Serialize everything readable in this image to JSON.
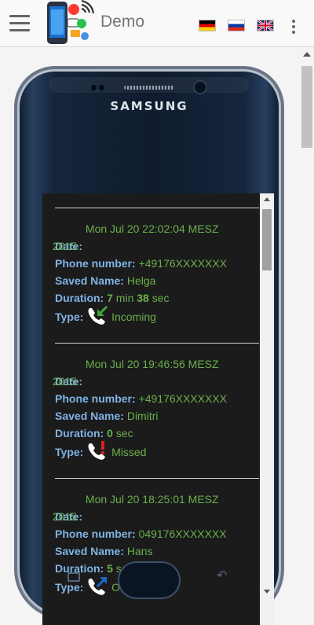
{
  "app": {
    "title": "Demo"
  },
  "flags": [
    {
      "name": "german",
      "colors": [
        "#000000",
        "#dd0000",
        "#ffce00"
      ]
    },
    {
      "name": "russian",
      "colors": [
        "#ffffff",
        "#0039a6",
        "#d52b1e"
      ]
    },
    {
      "name": "english",
      "colors": [
        "#012169",
        "#ffffff",
        "#c8102e"
      ]
    }
  ],
  "device": {
    "brand": "SAMSUNG"
  },
  "labels": {
    "date": "Date:",
    "phone": "Phone number:",
    "saved": "Saved Name:",
    "duration": "Duration:",
    "type": "Type:",
    "min": "min",
    "sec": "sec"
  },
  "calls": [
    {
      "date": "Mon Jul 20 22:02:04 MESZ 2015",
      "phone": "+49176XXXXXXX",
      "name": "Helga",
      "minutes": "7",
      "seconds": "38",
      "type": "Incoming",
      "icon": "incoming-call-icon"
    },
    {
      "date": "Mon Jul 20 19:46:56 MESZ 2015",
      "phone": "+49176XXXXXXX",
      "name": "Dimitri",
      "seconds": "0",
      "type": "Missed",
      "icon": "missed-call-icon"
    },
    {
      "date": "Mon Jul 20 18:25:01 MESZ 2015",
      "phone": "049176XXXXXXX",
      "name": "Hans",
      "seconds": "5",
      "type": "Outgoing",
      "icon": "outgoing-call-icon"
    }
  ],
  "colors": {
    "label": "#7fb3e6",
    "value": "#6ab04c",
    "screen": "#1b1b1b",
    "missed": "#e02020",
    "incoming": "#3aa536",
    "outgoing": "#1b67c9"
  }
}
